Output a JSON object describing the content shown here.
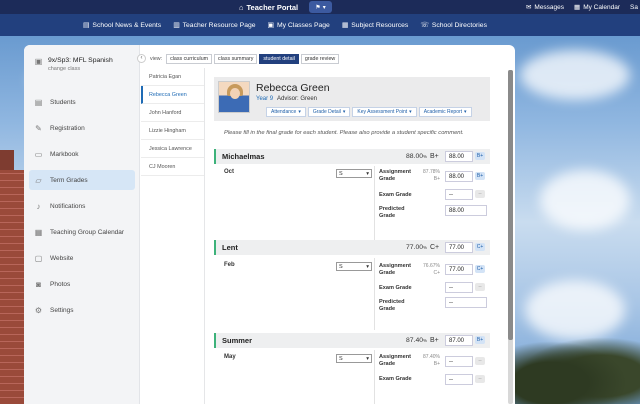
{
  "topbar": {
    "portal_title": "Teacher Portal",
    "messages": "Messages",
    "my_calendar": "My Calendar",
    "user_initials": "Sa"
  },
  "nav": {
    "items": [
      {
        "label": "School News & Events",
        "icon": "news-icon"
      },
      {
        "label": "Teacher Resource Page",
        "icon": "resource-icon"
      },
      {
        "label": "My Classes Page",
        "icon": "classes-icon"
      },
      {
        "label": "Subject Resources",
        "icon": "subject-icon"
      },
      {
        "label": "School Directories",
        "icon": "directory-icon"
      }
    ]
  },
  "class": {
    "title": "9x/Sp3: MFL Spanish",
    "change": "change class"
  },
  "sidebar": {
    "items": [
      {
        "label": "Students",
        "icon": "students-icon"
      },
      {
        "label": "Registration",
        "icon": "pencil-icon"
      },
      {
        "label": "Markbook",
        "icon": "book-icon"
      },
      {
        "label": "Term Grades",
        "icon": "folder-icon",
        "active": true
      },
      {
        "label": "Notifications",
        "icon": "bell-icon"
      },
      {
        "label": "Teaching Group Calendar",
        "icon": "calendar-icon"
      },
      {
        "label": "Website",
        "icon": "website-icon"
      },
      {
        "label": "Photos",
        "icon": "photo-icon"
      },
      {
        "label": "Settings",
        "icon": "gear-icon"
      }
    ]
  },
  "view": {
    "label": "view:",
    "tabs": [
      "class curriculum",
      "class summary",
      "student detail",
      "grade review"
    ],
    "active": "student detail"
  },
  "students": [
    "Patricia Egan",
    "Rebecca Green",
    "John Hanford",
    "Lizzie Hingham",
    "Jessica Lawrence",
    "CJ Mooren"
  ],
  "student": {
    "name": "Rebecca Green",
    "year": "Year 9",
    "advisor": "Advisor: Green",
    "dropdowns": [
      "Attendance",
      "Grade Detail",
      "Key Assessment Point",
      "Academic Report"
    ]
  },
  "instructions": "Please fill in the final grade for each student. Please also provide a student specific comment.",
  "terms": [
    {
      "name": "Michaelmas",
      "pct": "88.00",
      "pct_unit": "%",
      "letter": "B+",
      "input": "88.00",
      "tag": "B+",
      "month": "Oct",
      "select": "S",
      "assignment_label": "Assignment Grade",
      "assignment_pct": "87.78%",
      "assignment_letter": "B+",
      "assignment_input": "88.00",
      "assignment_tag": "B+",
      "exam_label": "Exam Grade",
      "exam_input": "--",
      "exam_tag": "--",
      "predicted_label": "Predicted Grade",
      "predicted_input": "88.00"
    },
    {
      "name": "Lent",
      "pct": "77.00",
      "pct_unit": "%",
      "letter": "C+",
      "input": "77.00",
      "tag": "C+",
      "month": "Feb",
      "select": "S",
      "assignment_label": "Assignment Grade",
      "assignment_pct": "76.67%",
      "assignment_letter": "C+",
      "assignment_input": "77.00",
      "assignment_tag": "C+",
      "exam_label": "Exam Grade",
      "exam_input": "--",
      "exam_tag": "--",
      "predicted_label": "Predicted Grade",
      "predicted_input": "--"
    },
    {
      "name": "Summer",
      "pct": "87.40",
      "pct_unit": "%",
      "letter": "B+",
      "input": "87.00",
      "tag": "B+",
      "month": "May",
      "select": "S",
      "assignment_label": "Assignment Grade",
      "assignment_pct": "87.40%",
      "assignment_letter": "B+",
      "assignment_input": "--",
      "assignment_tag": "--",
      "exam_label": "Exam Grade",
      "exam_input": "--",
      "exam_tag": "--"
    }
  ]
}
